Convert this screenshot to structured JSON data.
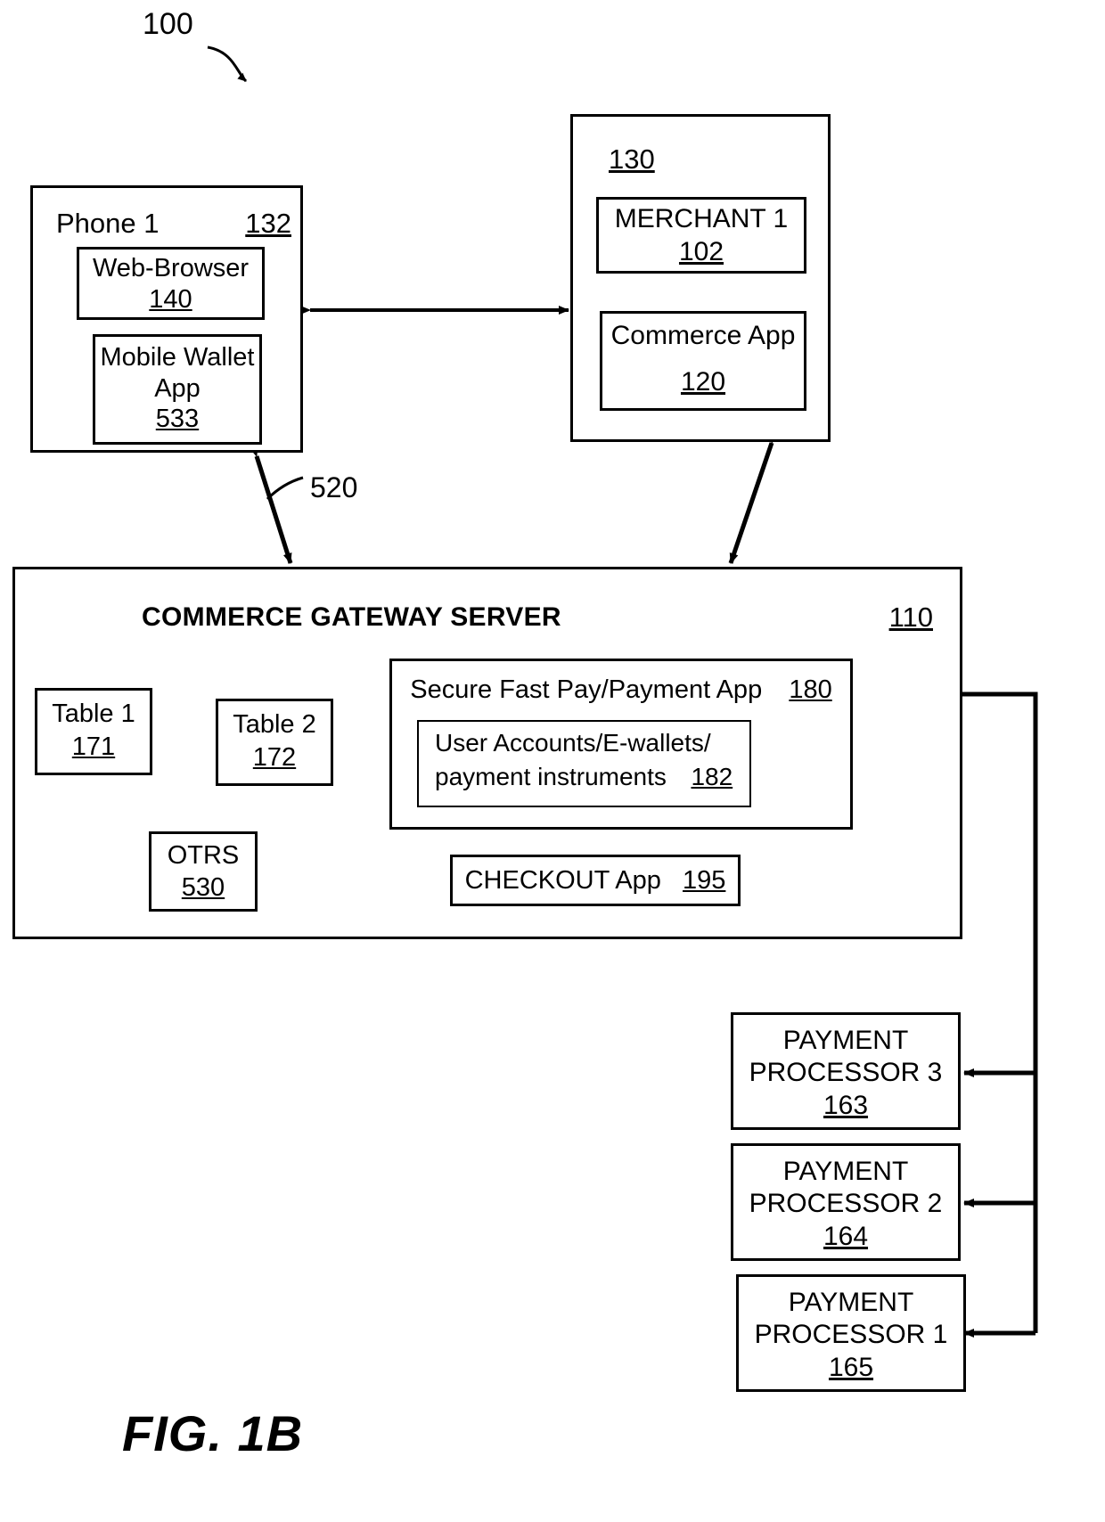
{
  "figure": {
    "caption": "FIG. 1B",
    "system_ref": "100"
  },
  "nodes": {
    "phone": {
      "title": "Phone 1",
      "ref": "132",
      "children": [
        {
          "label": "Web-Browser",
          "ref": "140"
        },
        {
          "label": "Mobile\nWallet App",
          "ref": "533"
        }
      ]
    },
    "merchant_group": {
      "ref": "130",
      "children": [
        {
          "label": "MERCHANT 1",
          "ref": "102"
        },
        {
          "label": "Commerce App",
          "ref": "120"
        }
      ]
    },
    "gateway": {
      "title": "COMMERCE GATEWAY SERVER",
      "ref": "110",
      "table1": {
        "label": "Table 1",
        "ref": "171"
      },
      "table2": {
        "label": "Table 2",
        "ref": "172"
      },
      "otrs": {
        "label": "OTRS",
        "ref": "530"
      },
      "secure_pay": {
        "label": "Secure Fast Pay/Payment App",
        "ref": "180",
        "inner": {
          "line1": "User Accounts/E-wallets/",
          "line2": "payment instruments",
          "ref": "182"
        }
      },
      "checkout": {
        "label": "CHECKOUT  App",
        "ref": "195"
      }
    },
    "processors": [
      {
        "line1": "PAYMENT",
        "line2": "PROCESSOR 3",
        "ref": "163"
      },
      {
        "line1": "PAYMENT",
        "line2": "PROCESSOR 2",
        "ref": "164"
      },
      {
        "line1": "PAYMENT",
        "line2": "PROCESSOR 1",
        "ref": "165"
      }
    ]
  },
  "connectors": {
    "phone_gateway_ref": "520"
  }
}
